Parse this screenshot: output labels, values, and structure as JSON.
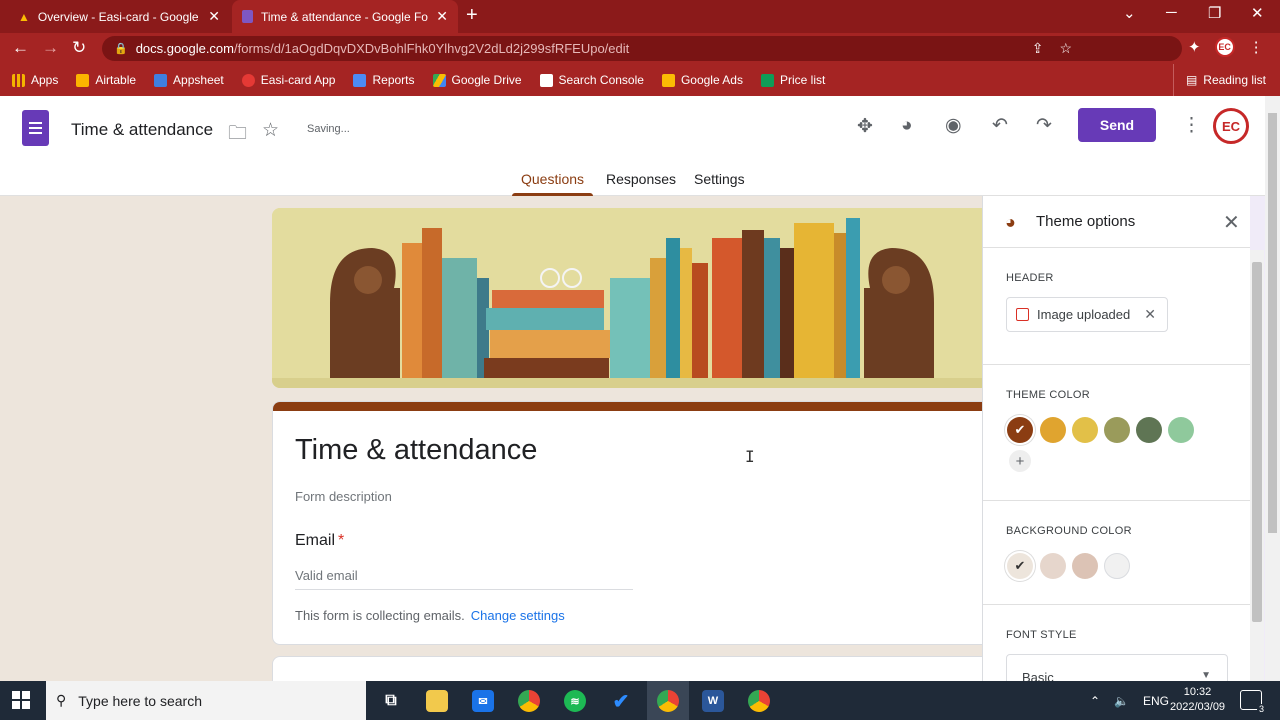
{
  "browser": {
    "tabs": [
      {
        "title": "Overview - Easi-card - Google Ac"
      },
      {
        "title": "Time & attendance - Google For"
      }
    ],
    "url_host": "docs.google.com",
    "url_path": "/forms/d/1aOgdDqvDXDvBohlFhk0Ylhvg2V2dLd2j299sfRFEUpo/edit",
    "bookmarks": [
      {
        "label": "Apps",
        "color": "#f4b400"
      },
      {
        "label": "Airtable",
        "color": "#fcb400"
      },
      {
        "label": "Appsheet",
        "color": "#3f7fe0"
      },
      {
        "label": "Easi-card App",
        "color": "#e53935"
      },
      {
        "label": "Reports",
        "color": "#4c8bf5"
      },
      {
        "label": "Google Drive",
        "color": "#34a853"
      },
      {
        "label": "Search Console",
        "color": "#ffffff"
      },
      {
        "label": "Google Ads",
        "color": "#fbbc04"
      },
      {
        "label": "Price list",
        "color": "#0f9d58"
      }
    ],
    "reading_list": "Reading list"
  },
  "forms": {
    "doc_title": "Time & attendance",
    "saving": "Saving...",
    "send": "Send",
    "avatar": "EC",
    "tabs": {
      "questions": "Questions",
      "responses": "Responses",
      "settings": "Settings"
    },
    "form_title": "Time & attendance",
    "form_description": "Form description",
    "email_label": "Email",
    "email_required": "*",
    "email_placeholder": "Valid email",
    "collect_note": "This form is collecting emails.",
    "change_settings": "Change settings"
  },
  "theme": {
    "title": "Theme options",
    "header_label": "HEADER",
    "header_chip": "Image uploaded",
    "theme_color_label": "THEME COLOR",
    "theme_colors": [
      "#8b3d12",
      "#e0a42f",
      "#e2c048",
      "#9a9b5b",
      "#5f7554",
      "#8fc99c"
    ],
    "background_color_label": "BACKGROUND COLOR",
    "background_colors": [
      "#ede5dc",
      "#e6d6cc",
      "#dcc3b5",
      "#f1f1f1"
    ],
    "font_style_label": "FONT STYLE",
    "font_style_value": "Basic"
  },
  "taskbar": {
    "search_placeholder": "Type here to search",
    "language": "ENG",
    "time": "10:32",
    "date": "2022/03/09",
    "notifications": "3"
  }
}
